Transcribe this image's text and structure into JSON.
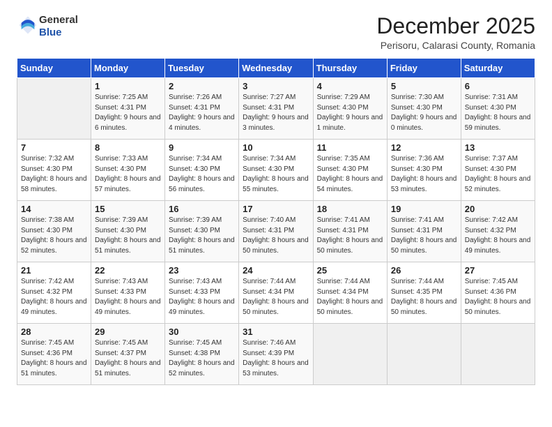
{
  "header": {
    "logo_line1": "General",
    "logo_line2": "Blue",
    "month": "December 2025",
    "location": "Perisoru, Calarasi County, Romania"
  },
  "days_of_week": [
    "Sunday",
    "Monday",
    "Tuesday",
    "Wednesday",
    "Thursday",
    "Friday",
    "Saturday"
  ],
  "weeks": [
    [
      {
        "day": "",
        "content": ""
      },
      {
        "day": "1",
        "content": "Sunrise: 7:25 AM\nSunset: 4:31 PM\nDaylight: 9 hours\nand 6 minutes."
      },
      {
        "day": "2",
        "content": "Sunrise: 7:26 AM\nSunset: 4:31 PM\nDaylight: 9 hours\nand 4 minutes."
      },
      {
        "day": "3",
        "content": "Sunrise: 7:27 AM\nSunset: 4:31 PM\nDaylight: 9 hours\nand 3 minutes."
      },
      {
        "day": "4",
        "content": "Sunrise: 7:29 AM\nSunset: 4:30 PM\nDaylight: 9 hours\nand 1 minute."
      },
      {
        "day": "5",
        "content": "Sunrise: 7:30 AM\nSunset: 4:30 PM\nDaylight: 9 hours\nand 0 minutes."
      },
      {
        "day": "6",
        "content": "Sunrise: 7:31 AM\nSunset: 4:30 PM\nDaylight: 8 hours\nand 59 minutes."
      }
    ],
    [
      {
        "day": "7",
        "content": "Sunrise: 7:32 AM\nSunset: 4:30 PM\nDaylight: 8 hours\nand 58 minutes."
      },
      {
        "day": "8",
        "content": "Sunrise: 7:33 AM\nSunset: 4:30 PM\nDaylight: 8 hours\nand 57 minutes."
      },
      {
        "day": "9",
        "content": "Sunrise: 7:34 AM\nSunset: 4:30 PM\nDaylight: 8 hours\nand 56 minutes."
      },
      {
        "day": "10",
        "content": "Sunrise: 7:34 AM\nSunset: 4:30 PM\nDaylight: 8 hours\nand 55 minutes."
      },
      {
        "day": "11",
        "content": "Sunrise: 7:35 AM\nSunset: 4:30 PM\nDaylight: 8 hours\nand 54 minutes."
      },
      {
        "day": "12",
        "content": "Sunrise: 7:36 AM\nSunset: 4:30 PM\nDaylight: 8 hours\nand 53 minutes."
      },
      {
        "day": "13",
        "content": "Sunrise: 7:37 AM\nSunset: 4:30 PM\nDaylight: 8 hours\nand 52 minutes."
      }
    ],
    [
      {
        "day": "14",
        "content": "Sunrise: 7:38 AM\nSunset: 4:30 PM\nDaylight: 8 hours\nand 52 minutes."
      },
      {
        "day": "15",
        "content": "Sunrise: 7:39 AM\nSunset: 4:30 PM\nDaylight: 8 hours\nand 51 minutes."
      },
      {
        "day": "16",
        "content": "Sunrise: 7:39 AM\nSunset: 4:30 PM\nDaylight: 8 hours\nand 51 minutes."
      },
      {
        "day": "17",
        "content": "Sunrise: 7:40 AM\nSunset: 4:31 PM\nDaylight: 8 hours\nand 50 minutes."
      },
      {
        "day": "18",
        "content": "Sunrise: 7:41 AM\nSunset: 4:31 PM\nDaylight: 8 hours\nand 50 minutes."
      },
      {
        "day": "19",
        "content": "Sunrise: 7:41 AM\nSunset: 4:31 PM\nDaylight: 8 hours\nand 50 minutes."
      },
      {
        "day": "20",
        "content": "Sunrise: 7:42 AM\nSunset: 4:32 PM\nDaylight: 8 hours\nand 49 minutes."
      }
    ],
    [
      {
        "day": "21",
        "content": "Sunrise: 7:42 AM\nSunset: 4:32 PM\nDaylight: 8 hours\nand 49 minutes."
      },
      {
        "day": "22",
        "content": "Sunrise: 7:43 AM\nSunset: 4:33 PM\nDaylight: 8 hours\nand 49 minutes."
      },
      {
        "day": "23",
        "content": "Sunrise: 7:43 AM\nSunset: 4:33 PM\nDaylight: 8 hours\nand 49 minutes."
      },
      {
        "day": "24",
        "content": "Sunrise: 7:44 AM\nSunset: 4:34 PM\nDaylight: 8 hours\nand 50 minutes."
      },
      {
        "day": "25",
        "content": "Sunrise: 7:44 AM\nSunset: 4:34 PM\nDaylight: 8 hours\nand 50 minutes."
      },
      {
        "day": "26",
        "content": "Sunrise: 7:44 AM\nSunset: 4:35 PM\nDaylight: 8 hours\nand 50 minutes."
      },
      {
        "day": "27",
        "content": "Sunrise: 7:45 AM\nSunset: 4:36 PM\nDaylight: 8 hours\nand 50 minutes."
      }
    ],
    [
      {
        "day": "28",
        "content": "Sunrise: 7:45 AM\nSunset: 4:36 PM\nDaylight: 8 hours\nand 51 minutes."
      },
      {
        "day": "29",
        "content": "Sunrise: 7:45 AM\nSunset: 4:37 PM\nDaylight: 8 hours\nand 51 minutes."
      },
      {
        "day": "30",
        "content": "Sunrise: 7:45 AM\nSunset: 4:38 PM\nDaylight: 8 hours\nand 52 minutes."
      },
      {
        "day": "31",
        "content": "Sunrise: 7:46 AM\nSunset: 4:39 PM\nDaylight: 8 hours\nand 53 minutes."
      },
      {
        "day": "",
        "content": ""
      },
      {
        "day": "",
        "content": ""
      },
      {
        "day": "",
        "content": ""
      }
    ]
  ]
}
